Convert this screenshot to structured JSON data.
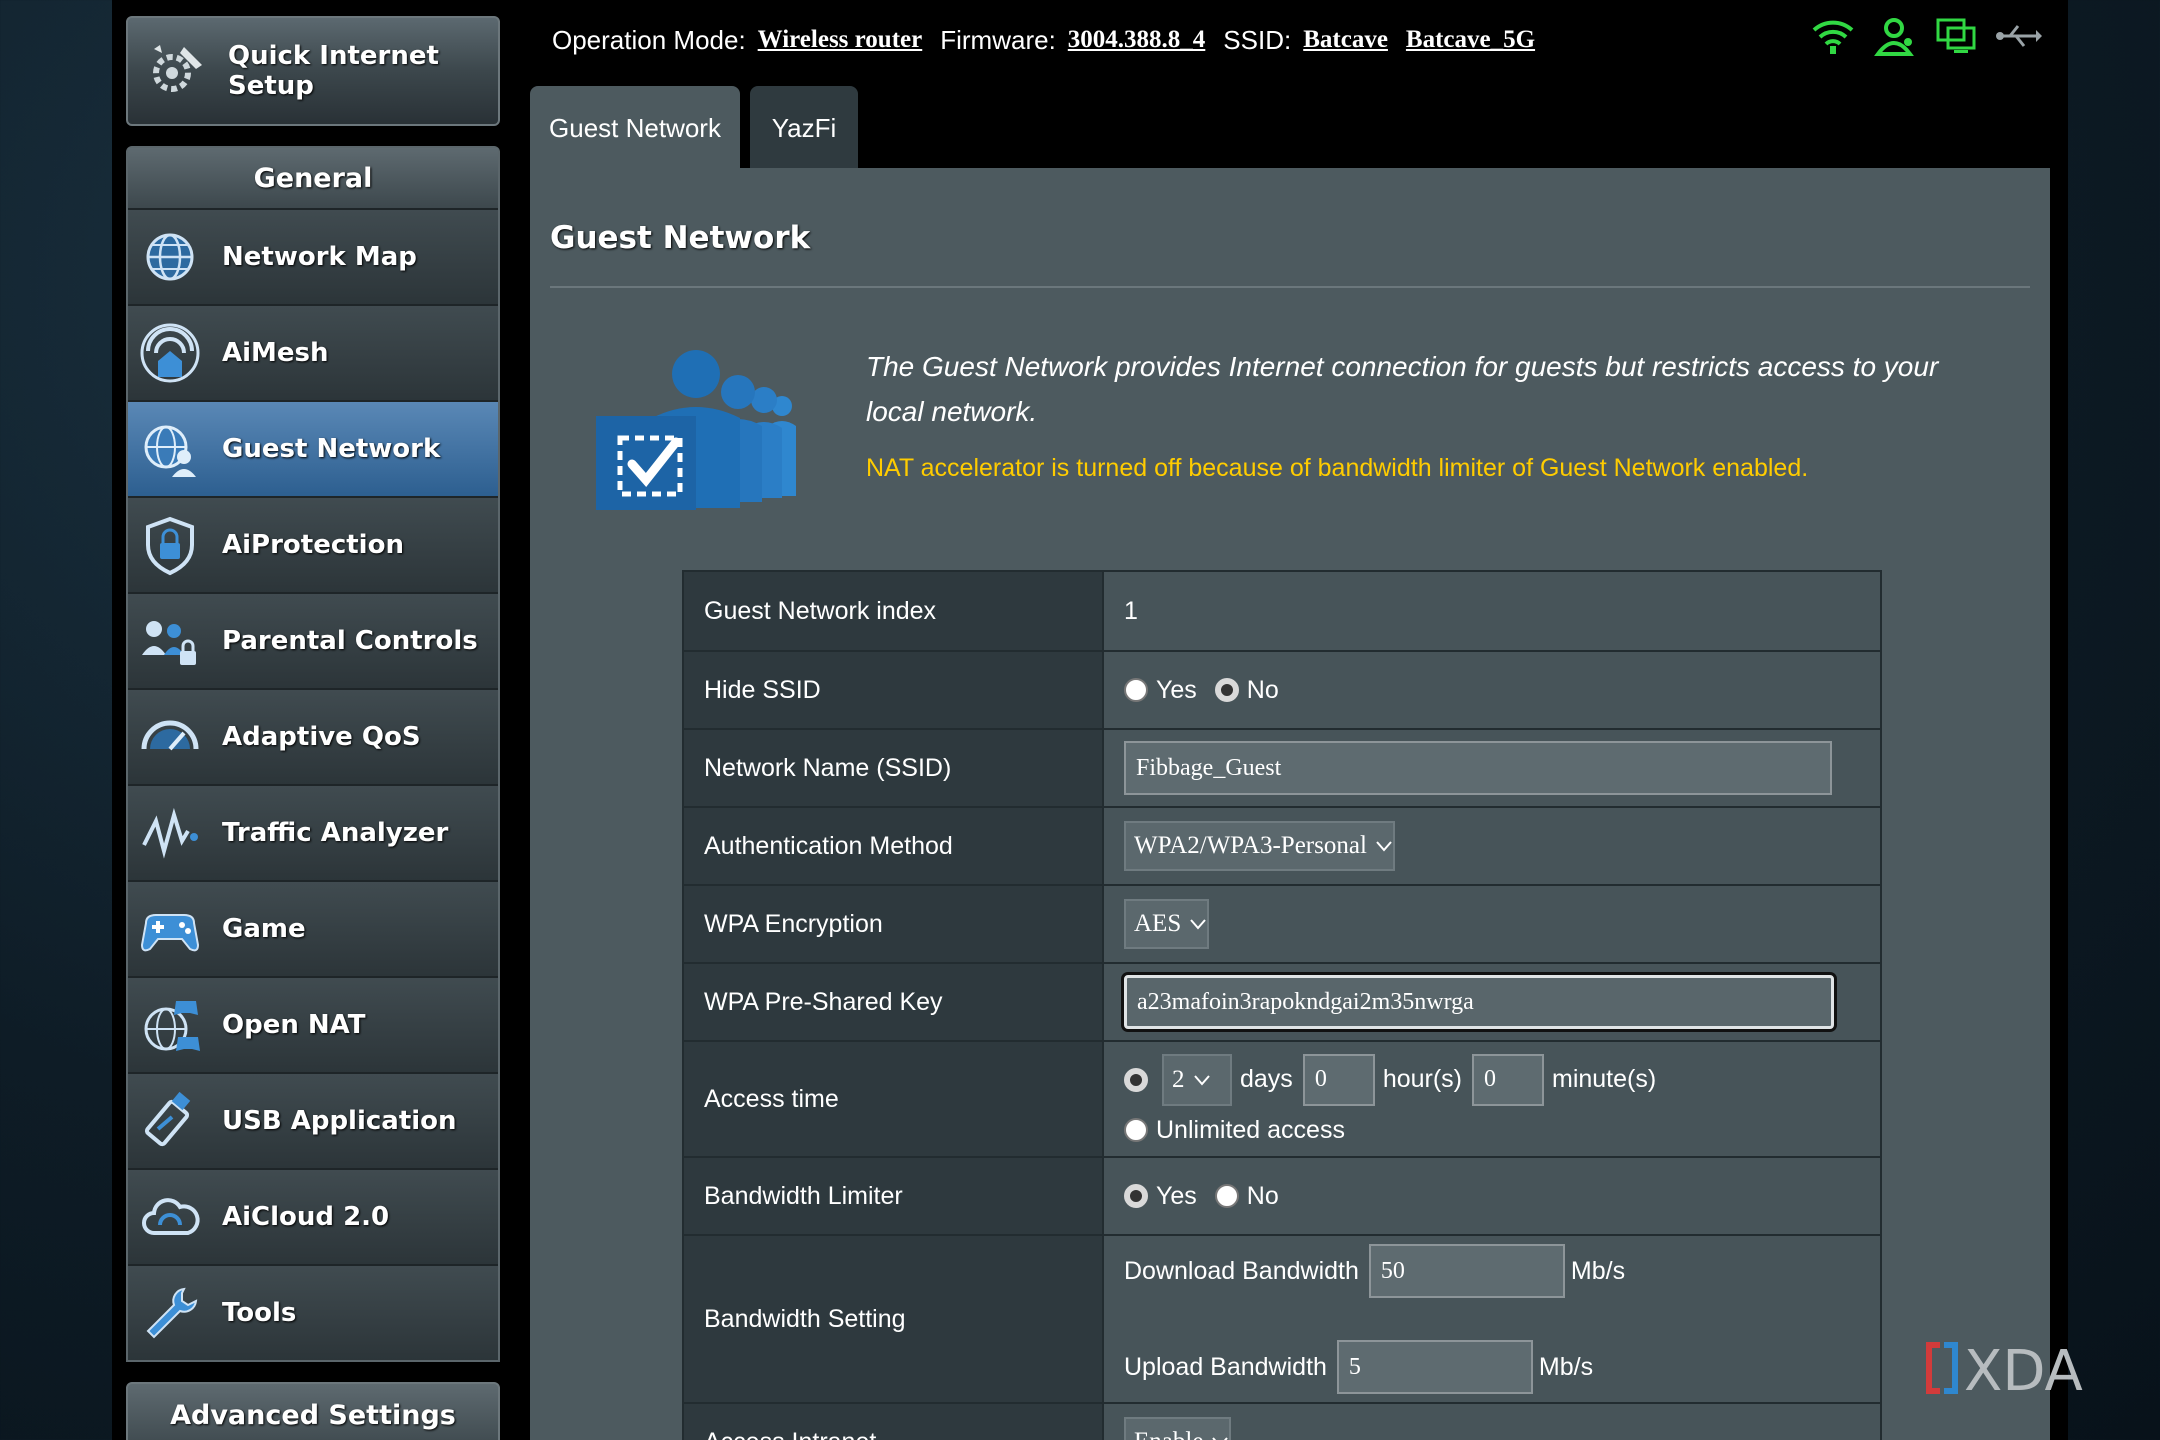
{
  "sidebar": {
    "quick_setup": "Quick Internet\nSetup",
    "general_header": "General",
    "items": [
      {
        "label": "Network Map"
      },
      {
        "label": "AiMesh"
      },
      {
        "label": "Guest Network"
      },
      {
        "label": "AiProtection"
      },
      {
        "label": "Parental Controls"
      },
      {
        "label": "Adaptive QoS"
      },
      {
        "label": "Traffic Analyzer"
      },
      {
        "label": "Game"
      },
      {
        "label": "Open NAT"
      },
      {
        "label": "USB Application"
      },
      {
        "label": "AiCloud 2.0"
      },
      {
        "label": "Tools"
      }
    ],
    "advanced_header": "Advanced Settings"
  },
  "topbar": {
    "op_mode_label": "Operation Mode:",
    "op_mode_value": "Wireless router",
    "firmware_label": "Firmware:",
    "firmware_value": "3004.388.8_4",
    "ssid_label": "SSID:",
    "ssid_1": "Batcave",
    "ssid_2": "Batcave_5G"
  },
  "tabs": [
    {
      "label": "Guest Network",
      "active": true
    },
    {
      "label": "YazFi",
      "active": false
    }
  ],
  "page": {
    "title": "Guest Network",
    "description": "The Guest Network provides Internet connection for guests but restricts access to your local network.",
    "warning": "NAT accelerator is turned off because of bandwidth limiter of Guest Network enabled."
  },
  "form": {
    "index": {
      "label": "Guest Network index",
      "value": "1"
    },
    "hide_ssid": {
      "label": "Hide SSID",
      "yes": "Yes",
      "no": "No",
      "selected": "No"
    },
    "ssid": {
      "label": "Network Name (SSID)",
      "value": "Fibbage_Guest"
    },
    "auth": {
      "label": "Authentication Method",
      "value": "WPA2/WPA3-Personal"
    },
    "encryption": {
      "label": "WPA Encryption",
      "value": "AES"
    },
    "psk": {
      "label": "WPA Pre-Shared Key",
      "value": "a23mafoin3rapokndgai2m35nwrga"
    },
    "access_time": {
      "label": "Access time",
      "days": "2",
      "days_unit": "days",
      "hours": "0",
      "hours_unit": "hour(s)",
      "minutes": "0",
      "minutes_unit": "minute(s)",
      "unlimited": "Unlimited access",
      "selected": "limited"
    },
    "bw_limiter": {
      "label": "Bandwidth Limiter",
      "yes": "Yes",
      "no": "No",
      "selected": "Yes"
    },
    "bw_setting": {
      "label": "Bandwidth Setting",
      "download_label": "Download Bandwidth",
      "download_value": "50",
      "upload_label": "Upload Bandwidth",
      "upload_value": "5",
      "unit": "Mb/s"
    },
    "intranet": {
      "label": "Access Intranet",
      "value": "Enable"
    }
  },
  "watermark": "XDA",
  "colors": {
    "active_menu": "#3f74a8",
    "warning": "#ffcc00",
    "status_green": "#31d843"
  }
}
